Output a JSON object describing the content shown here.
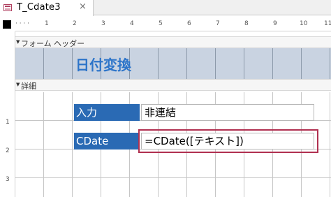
{
  "tab": {
    "title": "T_Cdate3",
    "close": "×"
  },
  "ruler": {
    "h_numbers": [
      "1",
      "2",
      "3",
      "4",
      "5",
      "6",
      "7",
      "8",
      "9",
      "10",
      "11"
    ],
    "v_numbers": [
      "1",
      "2",
      "3"
    ]
  },
  "sections": {
    "header_label": "フォーム ヘッダー",
    "detail_label": "詳細"
  },
  "form": {
    "title": "日付変換",
    "fields": [
      {
        "label": "入力",
        "value": "非連結"
      },
      {
        "label": "CDate",
        "value": "=CDate([テキスト])"
      }
    ]
  },
  "colors": {
    "label_bg": "#2a6ab4",
    "title_color": "#2e75c9",
    "header_bg": "#c9d3e1",
    "highlight": "#b03050"
  }
}
